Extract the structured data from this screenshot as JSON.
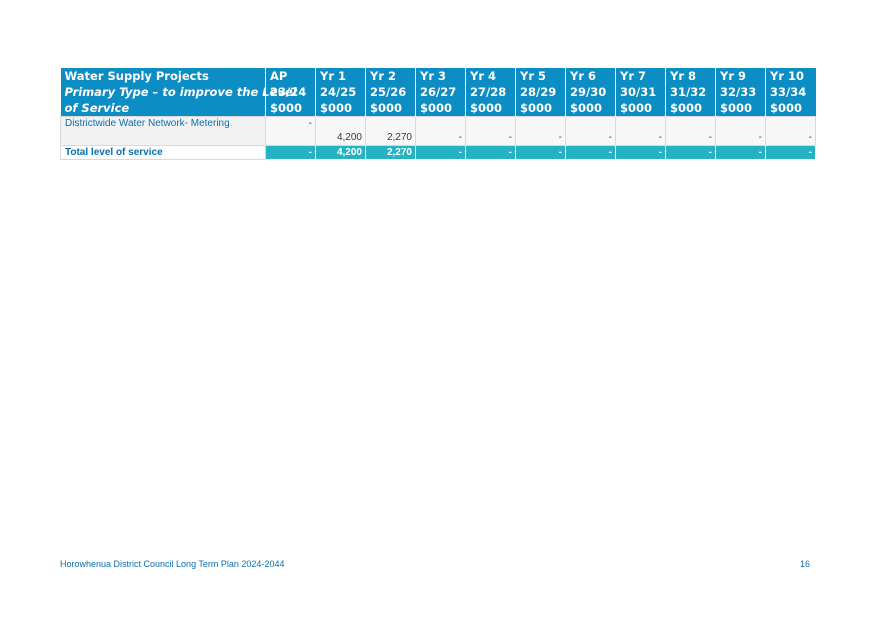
{
  "table": {
    "header": {
      "title_line1": "Water Supply Projects",
      "title_line2": "Primary Type – to improve the Level",
      "title_line3": "of Service",
      "columns": [
        {
          "label": "AP",
          "year": "23/24",
          "unit": "$000"
        },
        {
          "label": "Yr 1",
          "year": "24/25",
          "unit": "$000"
        },
        {
          "label": "Yr 2",
          "year": "25/26",
          "unit": "$000"
        },
        {
          "label": "Yr 3",
          "year": "26/27",
          "unit": "$000"
        },
        {
          "label": "Yr 4",
          "year": "27/28",
          "unit": "$000"
        },
        {
          "label": "Yr 5",
          "year": "28/29",
          "unit": "$000"
        },
        {
          "label": "Yr 6",
          "year": "29/30",
          "unit": "$000"
        },
        {
          "label": "Yr 7",
          "year": "30/31",
          "unit": "$000"
        },
        {
          "label": "Yr 8",
          "year": "31/32",
          "unit": "$000"
        },
        {
          "label": "Yr 9",
          "year": "32/33",
          "unit": "$000"
        },
        {
          "label": "Yr 10",
          "year": "33/34",
          "unit": "$000"
        }
      ]
    },
    "rows": [
      {
        "label": "Districtwide Water Network- Metering",
        "values": [
          "-",
          "4,200",
          "2,270",
          "-",
          "-",
          "-",
          "-",
          "-",
          "-",
          "-",
          "-"
        ]
      }
    ],
    "total": {
      "label": "Total level of service",
      "values": [
        "-",
        "4,200",
        "2,270",
        "-",
        "-",
        "-",
        "-",
        "-",
        "-",
        "-",
        "-"
      ]
    }
  },
  "footer": {
    "title": "Horowhenua District Council Long Term Plan 2024-2044",
    "page": "16"
  },
  "colors": {
    "header_bg": "#0c8ec4",
    "total_bg": "#25b3c4",
    "text_blue": "#0a6fb0"
  }
}
